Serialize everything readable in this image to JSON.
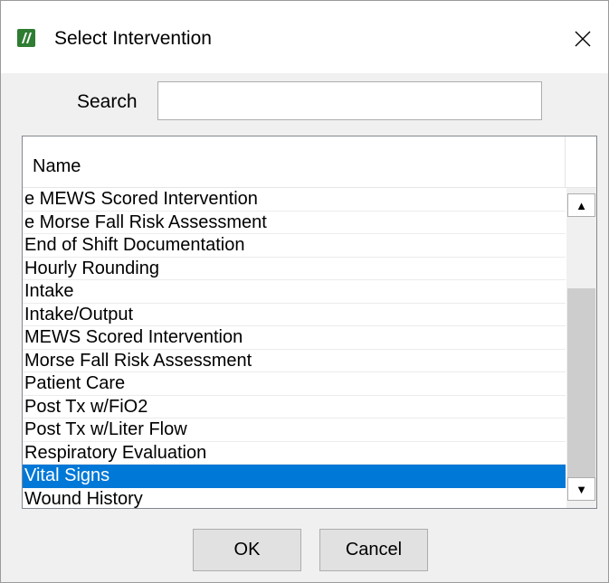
{
  "window": {
    "title": "Select Intervention",
    "icon": "app-logo-icon",
    "close_icon": "close-icon"
  },
  "search": {
    "label": "Search",
    "value": "",
    "placeholder": ""
  },
  "list": {
    "column_header": "Name",
    "items": [
      "e MEWS Scored Intervention",
      "e Morse Fall Risk Assessment",
      "End of Shift Documentation",
      "Hourly Rounding",
      "Intake",
      "Intake/Output",
      "MEWS Scored Intervention",
      "Morse Fall Risk Assessment",
      "Patient Care",
      "Post Tx w/FiO2",
      "Post Tx w/Liter Flow",
      "Respiratory Evaluation",
      "Vital Signs",
      "Wound History"
    ],
    "selected": "Vital Signs",
    "scroll_up_icon": "scroll-up-arrow-icon",
    "scroll_down_icon": "scroll-down-arrow-icon"
  },
  "buttons": {
    "ok": "OK",
    "cancel": "Cancel"
  },
  "colors": {
    "selection": "#0078d7",
    "app_icon": "#2e7d32"
  }
}
